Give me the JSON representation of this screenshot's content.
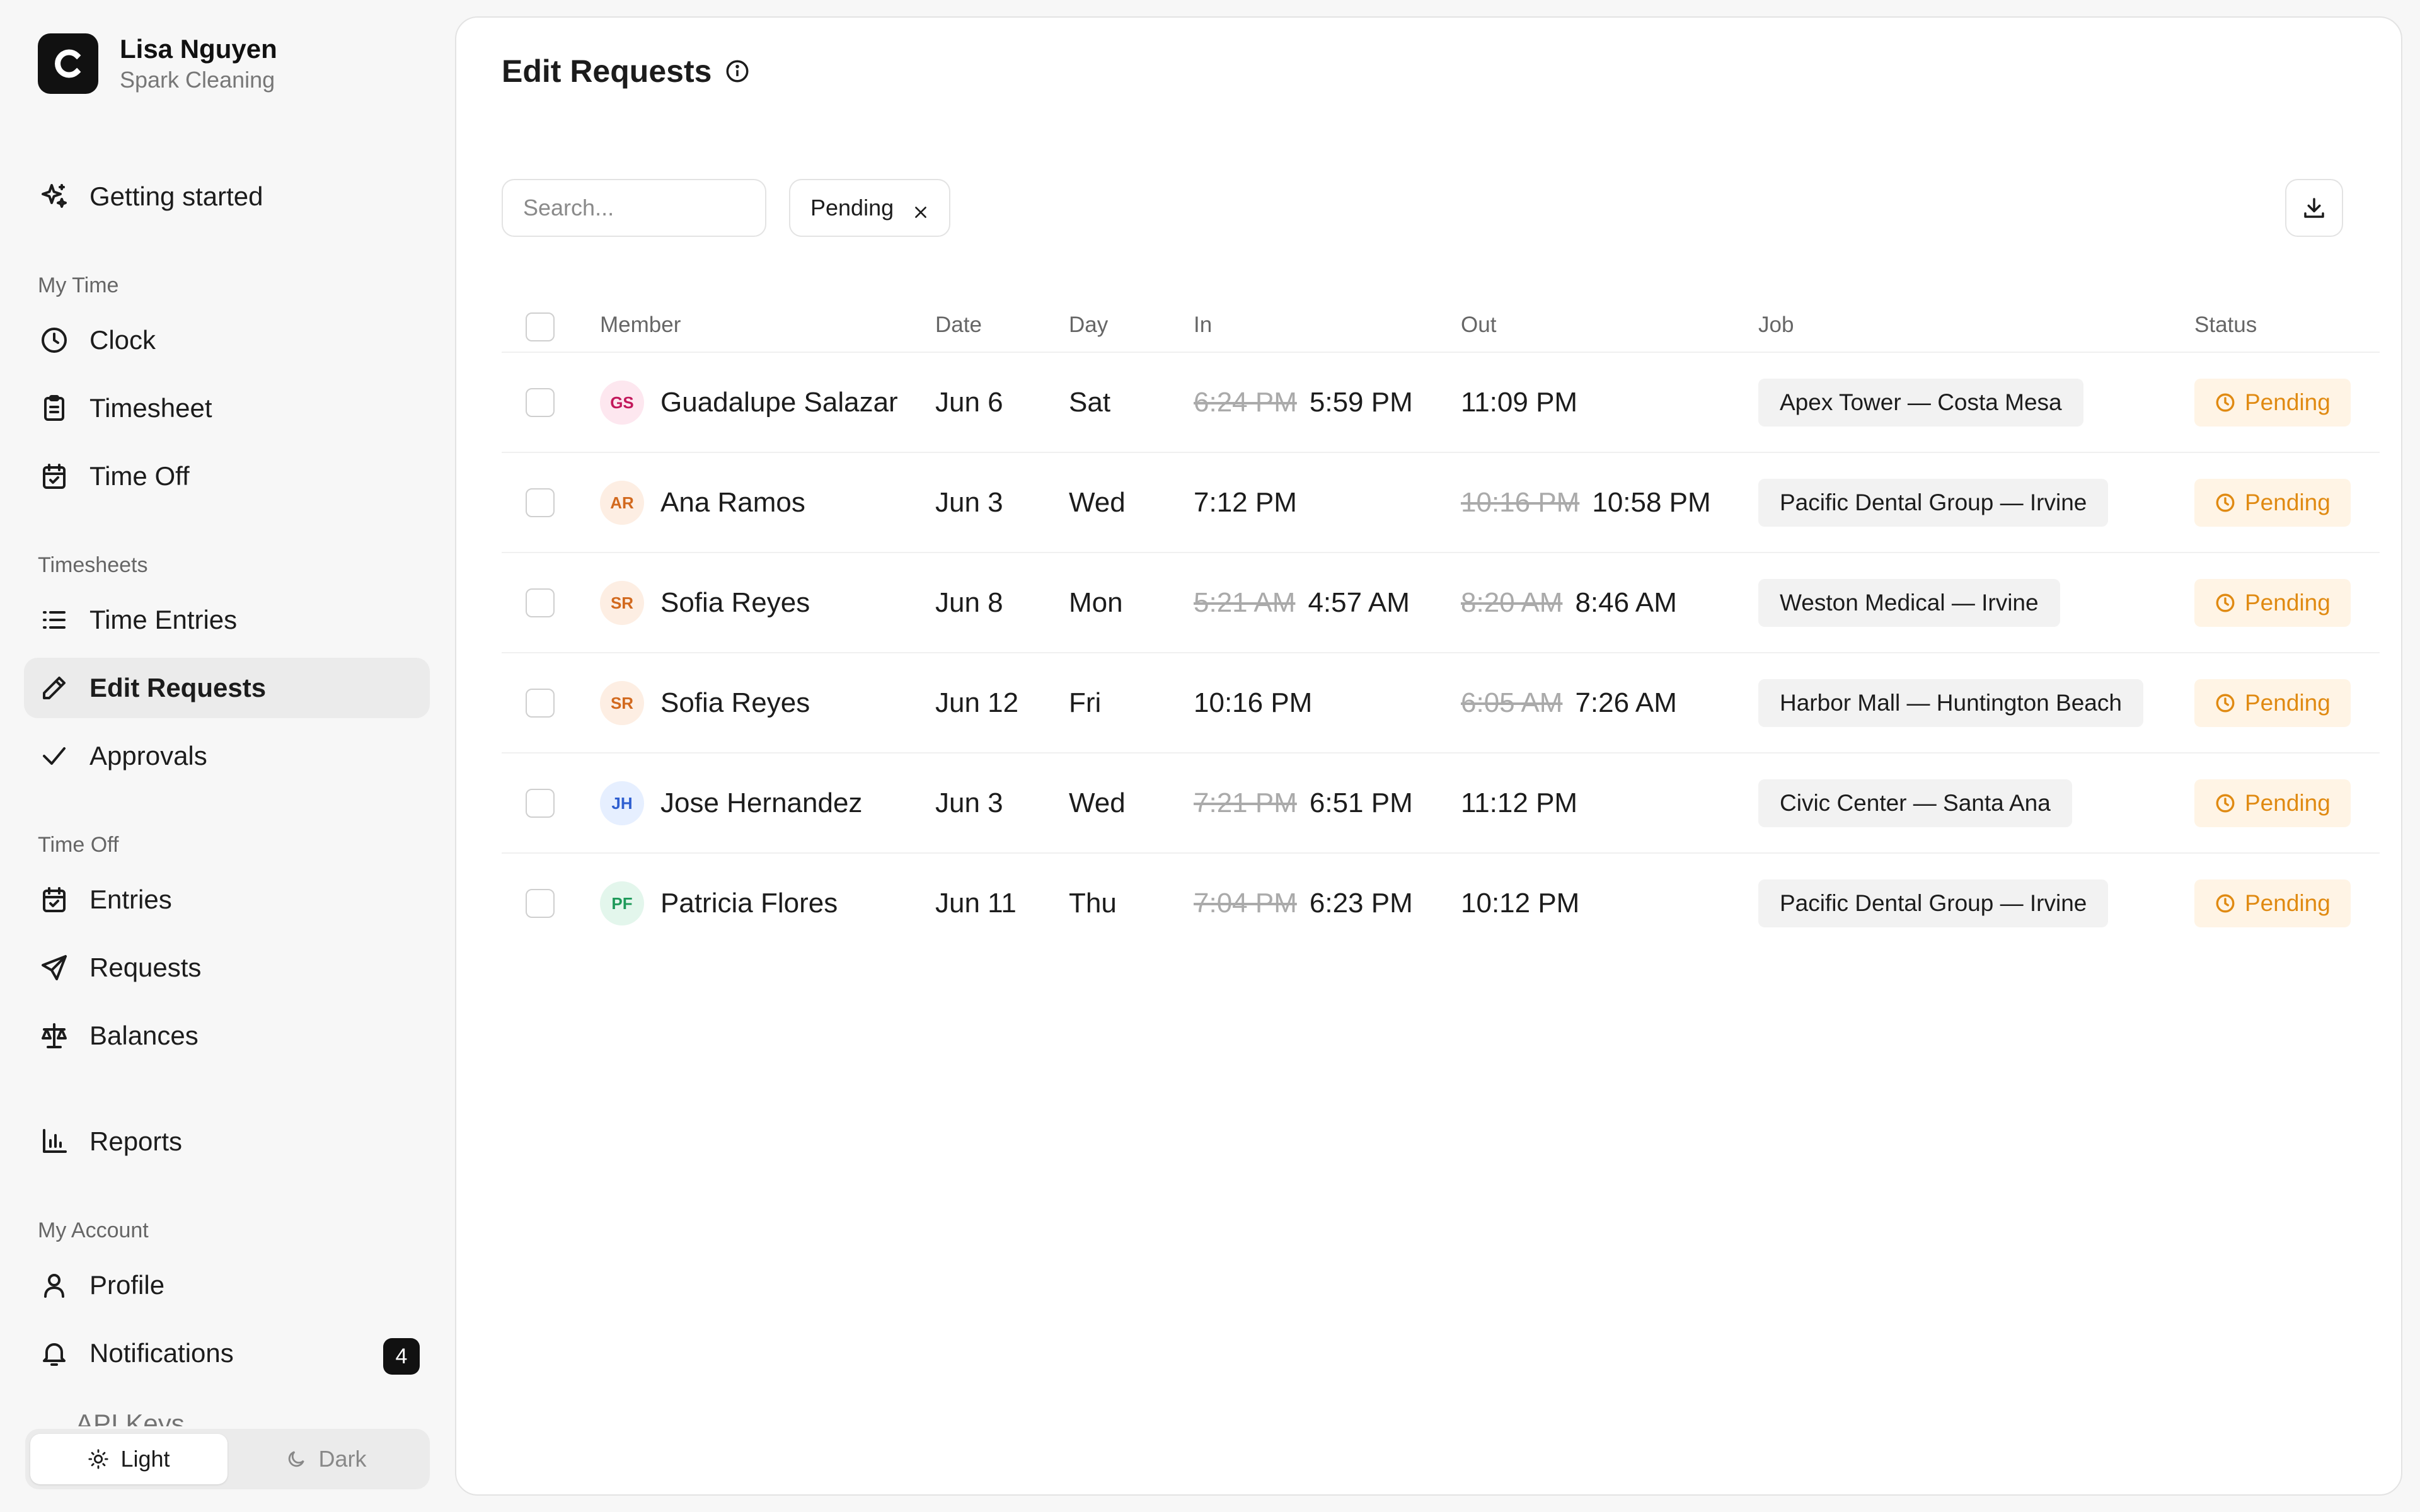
{
  "sidebar": {
    "user_name": "Lisa Nguyen",
    "org": "Spark Cleaning",
    "logo_letter": "C",
    "getting_started": "Getting started",
    "sections": {
      "my_time": "My Time",
      "timesheets": "Timesheets",
      "time_off": "Time Off",
      "my_account": "My Account"
    },
    "items": {
      "clock": "Clock",
      "timesheet": "Timesheet",
      "time_off": "Time Off",
      "time_entries": "Time Entries",
      "edit_requests": "Edit Requests",
      "approvals": "Approvals",
      "entries": "Entries",
      "requests": "Requests",
      "balances": "Balances",
      "reports": "Reports",
      "profile": "Profile",
      "notifications": "Notifications",
      "api_keys_partial": "API Keys"
    },
    "notifications_count": "4",
    "theme": {
      "light": "Light",
      "dark": "Dark",
      "selected": "Light"
    }
  },
  "main": {
    "title": "Edit Requests",
    "search_placeholder": "Search...",
    "filter_chip": "Pending",
    "columns": [
      "Member",
      "Date",
      "Day",
      "In",
      "Out",
      "Job",
      "Status"
    ],
    "rows": [
      {
        "initials": "GS",
        "member": "Guadalupe Salazar",
        "date": "Jun 6",
        "day": "Sat",
        "in_old": "6:24 PM",
        "in_new": "5:59 PM",
        "out_old": "",
        "out_new": "11:09 PM",
        "job": "Apex Tower — Costa Mesa",
        "status": "Pending",
        "avatar_bg": "#fde7ef",
        "avatar_fg": "#c2185b"
      },
      {
        "initials": "AR",
        "member": "Ana Ramos",
        "date": "Jun 3",
        "day": "Wed",
        "in_old": "",
        "in_new": "7:12 PM",
        "out_old": "10:16 PM",
        "out_new": "10:58 PM",
        "job": "Pacific Dental Group — Irvine",
        "status": "Pending",
        "avatar_bg": "#fdeee3",
        "avatar_fg": "#d2691e"
      },
      {
        "initials": "SR",
        "member": "Sofia Reyes",
        "date": "Jun 8",
        "day": "Mon",
        "in_old": "5:21 AM",
        "in_new": "4:57 AM",
        "out_old": "8:20 AM",
        "out_new": "8:46 AM",
        "job": "Weston Medical — Irvine",
        "status": "Pending",
        "avatar_bg": "#fdeee3",
        "avatar_fg": "#d2691e"
      },
      {
        "initials": "SR",
        "member": "Sofia Reyes",
        "date": "Jun 12",
        "day": "Fri",
        "in_old": "",
        "in_new": "10:16 PM",
        "out_old": "6:05 AM",
        "out_new": "7:26 AM",
        "job": "Harbor Mall — Huntington Beach",
        "status": "Pending",
        "avatar_bg": "#fdeee3",
        "avatar_fg": "#d2691e"
      },
      {
        "initials": "JH",
        "member": "Jose Hernandez",
        "date": "Jun 3",
        "day": "Wed",
        "in_old": "7:21 PM",
        "in_new": "6:51 PM",
        "out_old": "",
        "out_new": "11:12 PM",
        "job": "Civic Center — Santa Ana",
        "status": "Pending",
        "avatar_bg": "#e6efff",
        "avatar_fg": "#2f5fd0"
      },
      {
        "initials": "PF",
        "member": "Patricia Flores",
        "date": "Jun 11",
        "day": "Thu",
        "in_old": "7:04 PM",
        "in_new": "6:23 PM",
        "out_old": "",
        "out_new": "10:12 PM",
        "job": "Pacific Dental Group — Irvine",
        "status": "Pending",
        "avatar_bg": "#e3f6ec",
        "avatar_fg": "#1e9a5a"
      }
    ]
  },
  "colors": {
    "pending": "#e08a12",
    "pending_bg": "#fff4e5",
    "active_nav_bg": "#ebebeb"
  }
}
